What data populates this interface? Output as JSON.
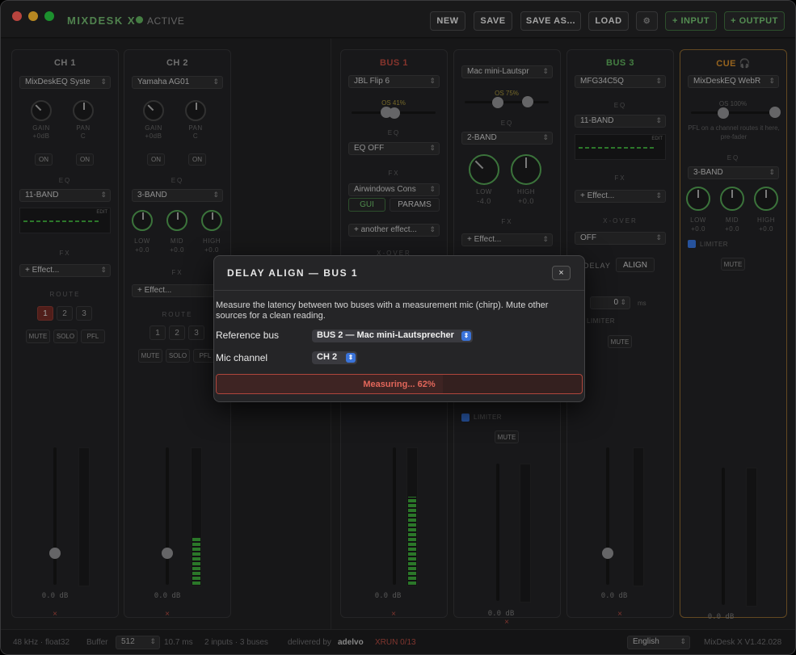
{
  "app": {
    "title": "MIXDESK X",
    "status": "ACTIVE",
    "accent": "#6fb56c"
  },
  "toolbar": {
    "new": "NEW",
    "save": "SAVE",
    "save_as": "SAVE AS...",
    "load": "LOAD",
    "gear": "⚙",
    "add_input": "+ INPUT",
    "add_output": "+ OUTPUT"
  },
  "ch1": {
    "title": "CH 1",
    "device": "MixDeskEQ Syste",
    "gain": "GAIN",
    "gain_val": "+0dB",
    "pan": "PAN",
    "pan_val": "C",
    "on1": "ON",
    "on2": "ON",
    "eq": "EQ",
    "eq_mode": "11-BAND",
    "edit": "EDIT",
    "fx": "FX",
    "effect": "+ Effect...",
    "route": "ROUTE",
    "r1": "1",
    "r2": "2",
    "r3": "3",
    "mute": "MUTE",
    "solo": "SOLO",
    "pfl": "PFL",
    "db": "0.0 dB",
    "x": "×",
    "fader_level": 0.23,
    "meter_level": 0.0
  },
  "ch2": {
    "title": "CH 2",
    "device": "Yamaha AG01",
    "gain": "GAIN",
    "gain_val": "+0dB",
    "pan": "PAN",
    "pan_val": "C",
    "on1": "ON",
    "on2": "ON",
    "eq": "EQ",
    "eq_mode": "3-BAND",
    "low": "LOW",
    "low_val": "+0.0",
    "mid": "MID",
    "mid_val": "+0.0",
    "high": "HIGH",
    "high_val": "+0.0",
    "fx": "FX",
    "effect": "+ Effect...",
    "route": "ROUTE",
    "r1": "1",
    "r2": "2",
    "r3": "3",
    "mute": "MUTE",
    "solo": "SOLO",
    "pfl": "PFL",
    "db": "0.0 dB",
    "x": "×",
    "fader_level": 0.23,
    "meter_level": 0.35
  },
  "bus1": {
    "title": "BUS 1",
    "color": "#b9483e",
    "device": "JBL Flip 6",
    "os": "OS 41%",
    "os_level": 0.41,
    "eq": "EQ",
    "eq_mode": "EQ OFF",
    "fx": "FX",
    "plugin": "Airwindows Cons",
    "gui": "GUI",
    "params": "PARAMS",
    "effect": "+ another effect...",
    "xover": "X-OVER",
    "db": "0.0 dB",
    "x": "×",
    "fader_level": 0.23,
    "meter_level": 0.64
  },
  "bus2": {
    "device": "Mac mini-Lautspr",
    "os": "OS 75%",
    "os_level": 0.75,
    "eq": "EQ",
    "eq_mode": "2-BAND",
    "low": "LOW",
    "low_val": "-4.0",
    "high": "HIGH",
    "high_val": "+0.0",
    "fx": "FX",
    "effect": "+ Effect...",
    "limiter": "LIMITER",
    "mute": "MUTE",
    "db": "0.0 dB",
    "x": "×",
    "fader_level": 0.23,
    "meter_level": 0.0
  },
  "bus3": {
    "title": "BUS 3",
    "color": "#5faf5c",
    "device": "MFG34C5Q",
    "eq": "EQ",
    "eq_mode": "11-BAND",
    "edit": "EDIT",
    "fx": "FX",
    "effect": "+ Effect...",
    "xover": "X-OVER",
    "xover_val": "OFF",
    "delay": "DELAY",
    "align": "ALIGN",
    "delay_val": "0",
    "ms": "ms",
    "limiter": "LIMITER",
    "mute": "MUTE",
    "db": "0.0 dB",
    "x": "×",
    "fader_level": 0.23,
    "meter_level": 0.0
  },
  "cue": {
    "title": "CUE 🎧",
    "color": "#d08a2a",
    "device": "MixDeskEQ WebR",
    "os": "OS 100%",
    "os_level": 1.0,
    "pfl_note": "PFL on a channel routes it here, pre-fader",
    "eq": "EQ",
    "eq_mode": "3-BAND",
    "low": "LOW",
    "low_val": "+0.0",
    "mid": "MID",
    "mid_val": "+0.0",
    "high": "HIGH",
    "high_val": "+0.0",
    "limiter": "LIMITER",
    "mute": "MUTE",
    "db": "0.0 dB",
    "fader_level": 0.23,
    "meter_level": 0.0
  },
  "status": {
    "rate": "48 kHz · float32",
    "buffer_label": "Buffer",
    "buffer": "512",
    "latency": "10.7 ms",
    "io": "2 inputs · 3 buses",
    "delivered": "delivered by",
    "brand": "adelvo",
    "xrun": "XRUN 0/13",
    "lang": "English",
    "version": "MixDesk X V1.42.028"
  },
  "modal": {
    "title": "DELAY ALIGN — BUS 1",
    "close": "×",
    "description": "Measure the latency between two buses with a measurement mic (chirp). Mute other sources for a clean reading.",
    "ref_label": "Reference bus",
    "ref_value": "BUS 2 — Mac mini-Lautsprecher",
    "mic_label": "Mic channel",
    "mic_value": "CH 2",
    "progress_text": "Measuring... 62%",
    "progress": 0.62
  }
}
